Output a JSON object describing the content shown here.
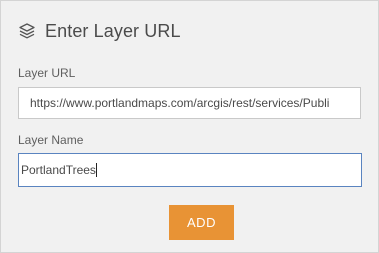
{
  "dialog": {
    "title": "Enter Layer URL",
    "header_icon": "layers-icon"
  },
  "fields": {
    "layer_url": {
      "label": "Layer URL",
      "value": "https://www.portlandmaps.com/arcgis/rest/services/Publi"
    },
    "layer_name": {
      "label": "Layer Name",
      "value": "PortlandTrees"
    }
  },
  "actions": {
    "add_label": "ADD"
  },
  "colors": {
    "accent": "#e89335",
    "focus_border": "#5a84c0",
    "panel_bg": "#f1f1f1"
  }
}
